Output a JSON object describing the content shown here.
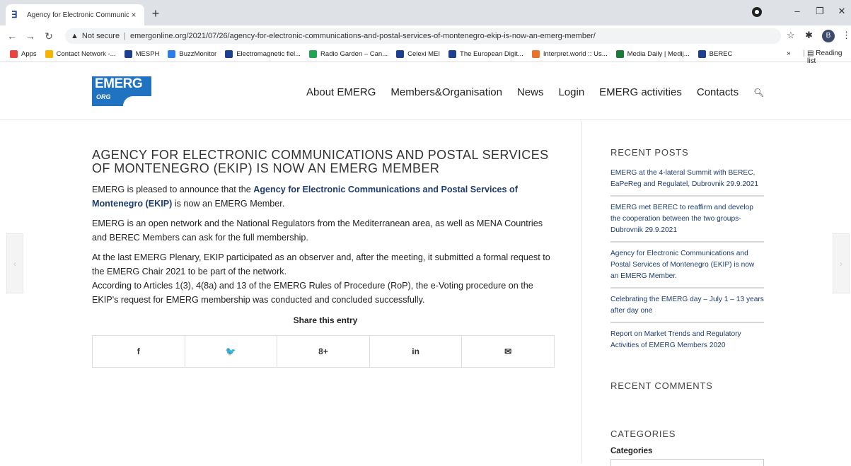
{
  "browser": {
    "tab_title": "Agency for Electronic Communic",
    "tab_close": "×",
    "new_tab": "+",
    "not_secure": "Not secure",
    "url": "emergonline.org/2021/07/26/agency-for-electronic-communications-and-postal-services-of-montenegro-ekip-is-now-an-emerg-member/",
    "avatar_letter": "B",
    "bookmarks": [
      {
        "label": "Apps",
        "color": "#e8453c"
      },
      {
        "label": "Contact Network -...",
        "color": "#f4b400"
      },
      {
        "label": "MESPH",
        "color": "#1d3f8f"
      },
      {
        "label": "BuzzMonitor",
        "color": "#2b7de9"
      },
      {
        "label": "Electromagnetic fiel...",
        "color": "#1d3f8f"
      },
      {
        "label": "Radio Garden – Can...",
        "color": "#23a455"
      },
      {
        "label": "Celexi MEI",
        "color": "#1d3f8f"
      },
      {
        "label": "The European Digit...",
        "color": "#1d3f8f"
      },
      {
        "label": "Interpret.world :: Us...",
        "color": "#e8712d"
      },
      {
        "label": "Media Daily | Medij...",
        "color": "#1a7a3a"
      },
      {
        "label": "BEREC",
        "color": "#1d3f8f"
      }
    ],
    "more_bookmarks": "»",
    "reading_list": "Reading list"
  },
  "site": {
    "logo_big": "EMERG",
    "logo_small": "ORG",
    "nav": [
      "About EMERG",
      "Members&Organisation",
      "News",
      "Login",
      "EMERG activities",
      "Contacts"
    ]
  },
  "article": {
    "title": "AGENCY FOR ELECTRONIC COMMUNICATIONS AND POSTAL SERVICES OF MONTENEGRO (EKIP) IS NOW AN EMERG MEMBER",
    "p1_before": "EMERG is pleased to announce that the ",
    "p1_link": "Agency for Electronic Communications and Postal Services of Montenegro (EKIP)",
    "p1_after": " is now an EMERG Member.",
    "p2": "EMERG is an open network and the National Regulators from the Mediterranean area, as well as MENA Countries and BEREC Members can ask for the full membership.",
    "p3": "At the last EMERG Plenary, EKIP participated as an observer and, after the meeting, it submitted a formal request to the EMERG Chair 2021 to be part of the network.",
    "p4": "According to Articles 1(3), 4(8a) and 13 of the EMERG Rules of Procedure (RoP), the e-Voting procedure on the EKIP's request for EMERG membership was conducted and concluded successfully.",
    "share_heading": "Share this entry",
    "share_icons": [
      "f",
      "🐦",
      "8+",
      "in",
      "✉"
    ]
  },
  "sidebar": {
    "recent_posts_heading": "RECENT POSTS",
    "posts": [
      "EMERG at the 4-lateral Summit with BEREC, EaPeReg and Regulatel, Dubrovnik 29.9.2021",
      "EMERG met BEREC to reaffirm and develop the cooperation between the two groups-Dubrovnik 29.9.2021",
      "Agency for Electronic Communications and Postal Services of Montenegro (EKIP) is now an EMERG Member.",
      "Celebrating the EMERG day – July 1 – 13 years after day one",
      "Report on Market Trends and Regulatory Activities of EMERG Members 2020"
    ],
    "recent_comments_heading": "RECENT COMMENTS",
    "categories_heading": "CATEGORIES",
    "categories_label": "Categories"
  }
}
